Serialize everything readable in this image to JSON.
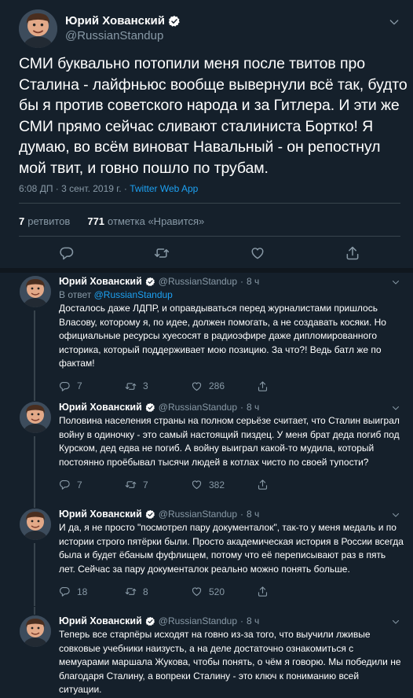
{
  "main_tweet": {
    "display_name": "Юрий Хованский",
    "handle": "@RussianStandup",
    "text": "СМИ буквально потопили меня после твитов про Сталина - лайфньюс вообще вывернули всё так, будто бы  я против советского народа и за Гитлера. И эти же СМИ прямо сейчас сливают сталиниста Бортко! Я думаю, во всём виноват Навальный - он репостнул мой твит, и говно пошло по трубам.",
    "timestamp": "6:08 ДП · 3 сент. 2019 г. · ",
    "source": "Twitter Web App",
    "retweets_count": "7",
    "retweets_label": "ретвитов",
    "likes_count": "771",
    "likes_label": "отметка «Нравится»"
  },
  "replies": [
    {
      "display_name": "Юрий Хованский",
      "handle": "@RussianStandup",
      "dot": "·",
      "time": "8 ч",
      "in_reply_prefix": "В ответ ",
      "in_reply_handle": "@RussianStandup",
      "text": "Досталось даже ЛДПР, и оправдываться перед журналистами пришлось Власову, которому я, по идее, должен помогать, а не создавать косяки. Но официальные ресурсы хуесосят в радиоэфире даже дипломированного историка, который поддерживает мою позицию. За что?! Ведь батл же по фактам!",
      "replies": "7",
      "retweets": "3",
      "likes": "286"
    },
    {
      "display_name": "Юрий Хованский",
      "handle": "@RussianStandup",
      "dot": "·",
      "time": "8 ч",
      "text": "Половина населения страны на полном серьёзе считает, что Сталин выиграл войну в одиночку - это самый настоящий пиздец. У меня брат деда погиб под Курском, дед едва не погиб. А войну выиграл какой-то мудила, который постоянно проёбывал тысячи людей в котлах чисто по своей тупости?",
      "replies": "7",
      "retweets": "7",
      "likes": "382"
    },
    {
      "display_name": "Юрий Хованский",
      "handle": "@RussianStandup",
      "dot": "·",
      "time": "8 ч",
      "text": "И да, я не просто \"посмотрел пару документалок\", так-то у меня медаль и по истории строго пятёрки были. Просто академическая история в России всегда была и будет ёбаным фуфлищем, потому что её переписывают раз в пять лет. Сейчас за пару документалок реально можно понять больше.",
      "replies": "18",
      "retweets": "8",
      "likes": "520"
    },
    {
      "display_name": "Юрий Хованский",
      "handle": "@RussianStandup",
      "dot": "·",
      "time": "8 ч",
      "text": "Теперь все старпёры исходят на говно из-за того, что выучили лживые совковые учебники наизусть, а на деле достаточно ознакомиться с мемуарами маршала Жукова, чтобы понять, о чём я говорю. Мы победили не благодаря Сталину, а вопреки Сталину - это ключ к пониманию всей ситуации."
    }
  ],
  "icons": {
    "verified": "verified-badge-icon",
    "chevron": "chevron-down-icon",
    "reply": "reply-icon",
    "retweet": "retweet-icon",
    "like": "heart-icon",
    "share": "share-icon"
  },
  "colors": {
    "background": "#15202b",
    "accent": "#1da1f2",
    "muted": "#8899a6",
    "divider": "#38444d"
  }
}
